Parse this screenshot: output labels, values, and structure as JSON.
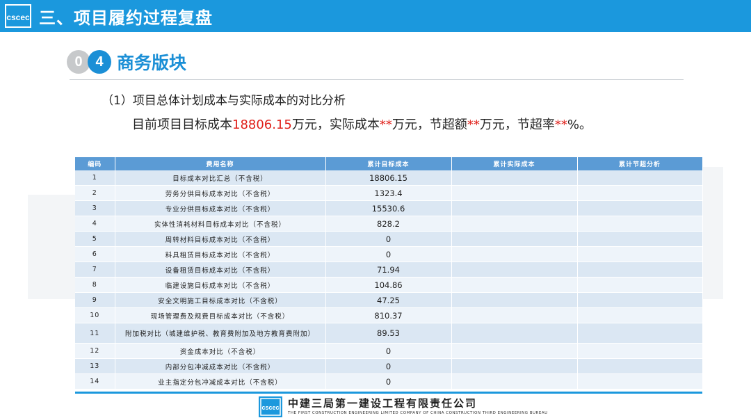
{
  "header": {
    "logo_text": "cscec",
    "title": "三、项目履约过程复盘"
  },
  "section": {
    "num_1": "0",
    "num_2": "4",
    "title": "商务版块"
  },
  "subtitle": "（1）项目总体计划成本与实际成本的对比分析",
  "summary": {
    "part1": "目前项目目标成本",
    "target_value": "18806.15",
    "part2": "万元，实际成本",
    "stars1": "**",
    "part3": "万元，节超额",
    "stars2": "**",
    "part4": "万元，节超率",
    "stars3": "**",
    "part5": "%。"
  },
  "table": {
    "headers": [
      "编码",
      "费用名称",
      "累计目标成本",
      "累计实际成本",
      "累计节超分析"
    ],
    "rows": [
      {
        "code": "1",
        "name": "目标成本对比汇总（不含税）",
        "target": "18806.15",
        "actual": "",
        "analysis": ""
      },
      {
        "code": "2",
        "name": "劳务分供目标成本对比（不含税）",
        "target": "1323.4",
        "actual": "",
        "analysis": ""
      },
      {
        "code": "3",
        "name": "专业分供目标成本对比（不含税）",
        "target": "15530.6",
        "actual": "",
        "analysis": ""
      },
      {
        "code": "4",
        "name": "实体性消耗材料目标成本对比（不含税）",
        "target": "828.2",
        "actual": "",
        "analysis": ""
      },
      {
        "code": "5",
        "name": "周转材料目标成本对比（不含税）",
        "target": "0",
        "actual": "",
        "analysis": ""
      },
      {
        "code": "6",
        "name": "料具租赁目标成本对比（不含税）",
        "target": "0",
        "actual": "",
        "analysis": ""
      },
      {
        "code": "7",
        "name": "设备租赁目标成本对比（不含税）",
        "target": "71.94",
        "actual": "",
        "analysis": ""
      },
      {
        "code": "8",
        "name": "临建设施目标成本对比（不含税）",
        "target": "104.86",
        "actual": "",
        "analysis": ""
      },
      {
        "code": "9",
        "name": "安全文明施工目标成本对比（不含税）",
        "target": "47.25",
        "actual": "",
        "analysis": ""
      },
      {
        "code": "10",
        "name": "现场管理费及规费目标成本对比（不含税）",
        "target": "810.37",
        "actual": "",
        "analysis": ""
      },
      {
        "code": "11",
        "name": "附加税对比（城建维护税、教育费附加及地方教育费附加）",
        "target": "89.53",
        "actual": "",
        "analysis": ""
      },
      {
        "code": "12",
        "name": "资金成本对比（不含税）",
        "target": "0",
        "actual": "",
        "analysis": ""
      },
      {
        "code": "13",
        "name": "内部分包冲减成本对比（不含税）",
        "target": "0",
        "actual": "",
        "analysis": ""
      },
      {
        "code": "14",
        "name": "业主指定分包冲减成本对比（不含税）",
        "target": "0",
        "actual": "",
        "analysis": ""
      }
    ]
  },
  "footer": {
    "company_cn": "中建三局第一建设工程有限责任公司",
    "company_en": "THE FIRST CONSTRUCTION ENGINEERING LIMITED COMPANY OF CHINA CONSTRUCTION THIRD ENGINEERING BUREAU"
  },
  "colors": {
    "header_blue": "#1b98dd",
    "accent_blue": "#1b8fd6",
    "table_header": "#5b9bd5",
    "red_highlight": "#e0201a"
  }
}
